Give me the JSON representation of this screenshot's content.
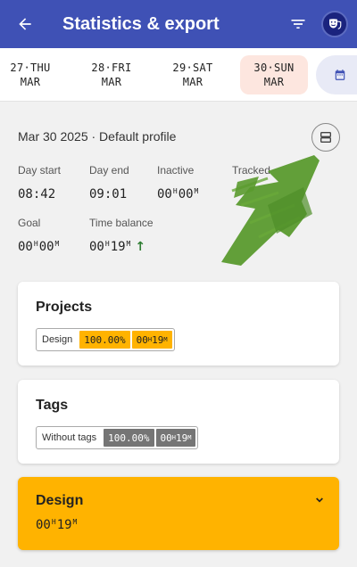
{
  "appbar": {
    "title": "Statistics & export",
    "back_icon": "arrow-back-icon",
    "filter_icon": "filter-icon",
    "profile_icon": "theater-mask-icon"
  },
  "days": [
    {
      "line1": "27·THU",
      "line2": "MAR",
      "selected": false
    },
    {
      "line1": "28·FRI",
      "line2": "MAR",
      "selected": false
    },
    {
      "line1": "29·SAT",
      "line2": "MAR",
      "selected": false
    },
    {
      "line1": "30·SUN",
      "line2": "MAR",
      "selected": true
    }
  ],
  "summary": {
    "header": "Mar 30 2025 · Default profile",
    "day_start": {
      "label": "Day start",
      "value": "08:42"
    },
    "day_end": {
      "label": "Day end",
      "value": "09:01"
    },
    "inactive": {
      "label": "Inactive",
      "h": "00",
      "m": "00"
    },
    "tracked": {
      "label": "Tracked"
    },
    "goal": {
      "label": "Goal",
      "h": "00",
      "m": "00"
    },
    "time_balance": {
      "label": "Time balance",
      "h": "00",
      "m": "19",
      "trend": "up"
    }
  },
  "projects": {
    "title": "Projects",
    "chip": {
      "name": "Design",
      "percent": "100.00%",
      "h": "00",
      "m": "19"
    }
  },
  "tags": {
    "title": "Tags",
    "chip": {
      "name": "Without tags",
      "percent": "100.00%",
      "h": "00",
      "m": "19"
    }
  },
  "project_detail": {
    "title": "Design",
    "h": "00",
    "m": "19"
  },
  "colors": {
    "appbar": "#3f51b5",
    "accent_orange": "#ffb300",
    "tag_grey": "#757575",
    "selected_day": "#fde6df",
    "trend_green": "#2e7d32",
    "scribble_green": "#5a9a2e"
  }
}
